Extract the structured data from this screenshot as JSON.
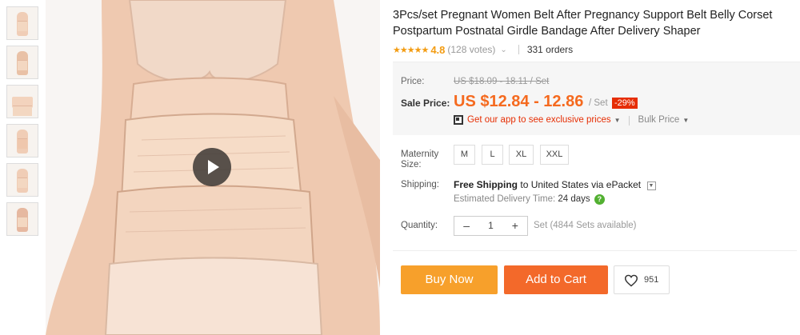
{
  "product": {
    "title": "3Pcs/set Pregnant Women Belt After Pregnancy Support Belt Belly Corset Postpartum Postnatal Girdle Bandage After Delivery Shaper",
    "stars": "★★★★★",
    "rating": "4.8",
    "votes": "(128 votes)",
    "orders": "331 orders"
  },
  "price": {
    "price_label": "Price:",
    "original": "US $18.09 - 18.11 / Set",
    "sale_label": "Sale Price:",
    "sale": "US $12.84 - 12.86",
    "unit": "/ Set",
    "discount": "-29%",
    "app_promo": "Get our app to see exclusive prices",
    "bulk_price": "Bulk Price"
  },
  "size": {
    "label": "Maternity Size:",
    "options": [
      "M",
      "L",
      "XL",
      "XXL"
    ]
  },
  "shipping": {
    "label": "Shipping:",
    "free": "Free Shipping",
    "to": "to",
    "country": "United States",
    "via": "via ePacket",
    "estimate_label": "Estimated Delivery Time:",
    "estimate_value": "24 days"
  },
  "quantity": {
    "label": "Quantity:",
    "minus": "–",
    "value": "1",
    "plus": "+",
    "available": "Set (4844 Sets available)"
  },
  "actions": {
    "buy_now": "Buy Now",
    "add_to_cart": "Add to Cart",
    "wishlist_count": "951"
  },
  "colors": {
    "sale_orange": "#f56a1f",
    "buy_now": "#f7a02b",
    "add_to_cart": "#f3692a",
    "discount_red": "#e62e04",
    "star": "#f39c12"
  },
  "icons": [
    "play-icon",
    "qr-code-icon",
    "dropdown-icon",
    "question-icon",
    "heart-icon"
  ]
}
